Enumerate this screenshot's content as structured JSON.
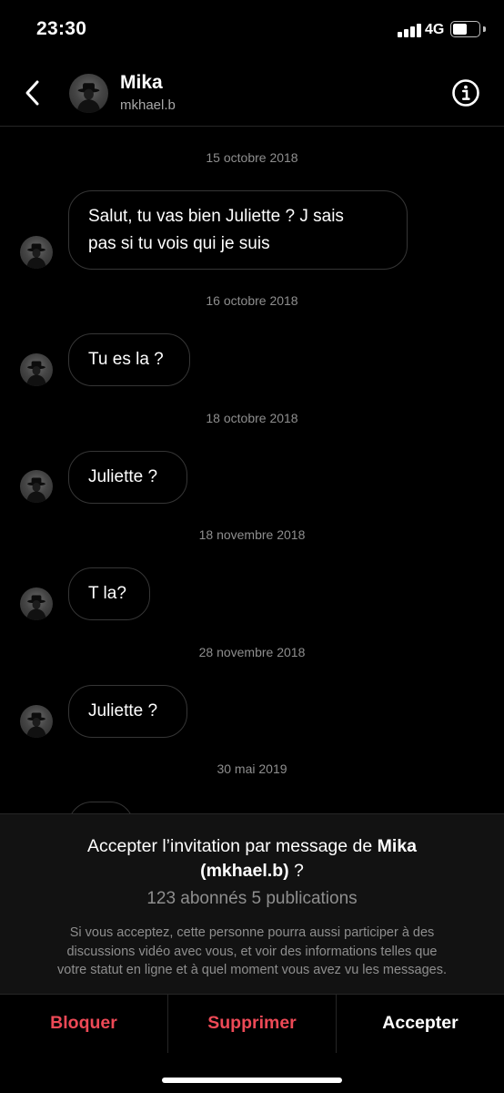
{
  "status_bar": {
    "time": "23:30",
    "network": "4G",
    "signal_bars": 4,
    "battery_level": 0.5
  },
  "header": {
    "name": "Mika",
    "username": "mkhael.b",
    "back_icon": "chevron-left-icon",
    "info_icon": "info-icon"
  },
  "thread": {
    "dates": [
      "15 octobre 2018",
      "16 octobre 2018",
      "18 octobre 2018",
      "18 novembre 2018",
      "28 novembre 2018",
      "30 mai 2019"
    ],
    "messages": [
      {
        "line1": "Salut,  tu vas bien Juliette ? J sais",
        "line2": "pas si tu vois qui je suis"
      },
      {
        "text": "Tu es la ?"
      },
      {
        "text": "Juliette ?"
      },
      {
        "text": "T la?"
      },
      {
        "text": "Juliette ?"
      }
    ]
  },
  "request": {
    "title_prefix": "Accepter l’invitation par message de ",
    "title_name": "Mika",
    "title_username": "(mkhael.b)",
    "title_suffix": " ?",
    "stats": "123 abonnés 5 publications",
    "description_line1": "Si vous acceptez, cette personne pourra aussi participer à des",
    "description_line2": "discussions vidéo avec vous, et voir des informations telles que",
    "description_line3": "votre statut en ligne et à quel moment vous avez vu les messages."
  },
  "actions": {
    "block": "Bloquer",
    "delete": "Supprimer",
    "accept": "Accepter"
  },
  "colors": {
    "background": "#000000",
    "danger": "#ed4956",
    "muted": "#8e8e8e",
    "panel": "#121212"
  }
}
